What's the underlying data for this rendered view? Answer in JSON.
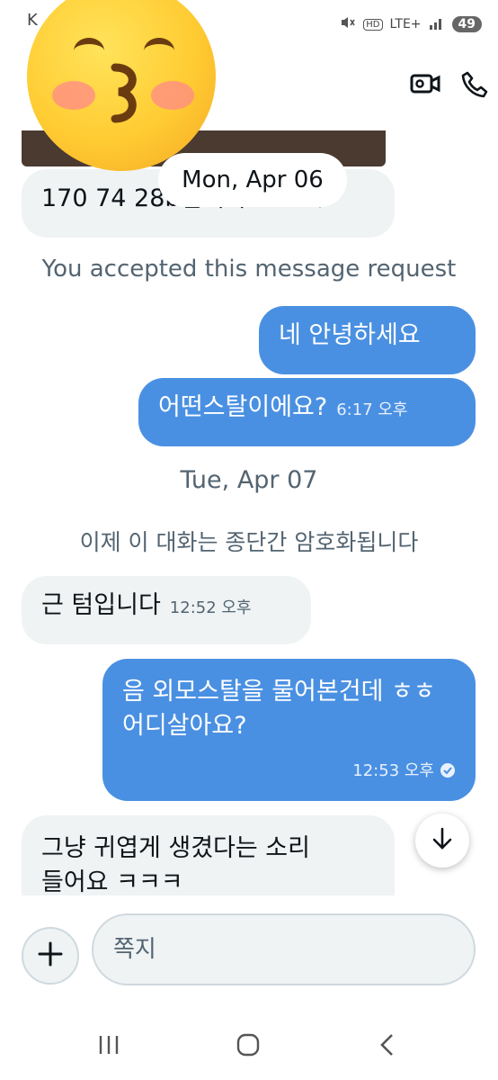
{
  "status_bar": {
    "left_text": "K",
    "network": "LTE+",
    "hd_label": "HD",
    "battery": "49"
  },
  "header": {
    "video_icon": "video-camera-icon",
    "call_icon": "phone-icon"
  },
  "dates": {
    "first": "Mon, Apr 06",
    "second": "Tue, Apr 07"
  },
  "notices": {
    "accepted": "You accepted this message request",
    "encrypted": "이제 이 대화는 종단간 암호화됩니다"
  },
  "messages": [
    {
      "text": "170 74 28b입니다",
      "time": "4:44 오후"
    },
    {
      "text": "네 안녕하세요",
      "time": ""
    },
    {
      "text": "어떤스탈이에요?",
      "time": "6:17 오후"
    },
    {
      "text": "근 텀입니다",
      "time": "12:52 오후"
    },
    {
      "text": "음 외모스탈을 물어본건데 ㅎㅎ어디살아요?",
      "time": "12:53 오후"
    },
    {
      "text": "그냥 귀엽게 생겼다는 소리들어요 ㅋㅋㅋ",
      "time": ""
    }
  ],
  "composer": {
    "placeholder": "쪽지"
  },
  "colors": {
    "outgoing": "#4a90e2",
    "incoming": "#eff3f4"
  }
}
